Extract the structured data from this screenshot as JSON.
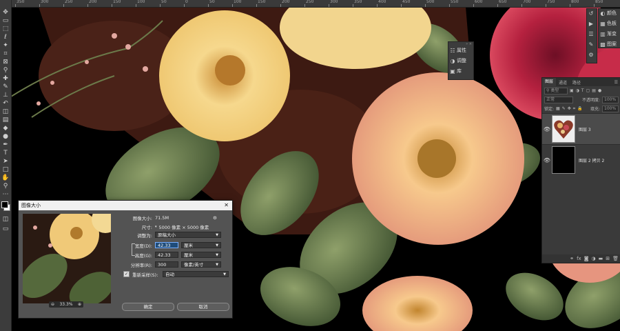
{
  "ruler": {
    "labels": [
      "350",
      "300",
      "250",
      "200",
      "150",
      "100",
      "50",
      "0",
      "50",
      "100",
      "150",
      "200",
      "250",
      "300",
      "350",
      "400",
      "450",
      "500",
      "550",
      "600",
      "650",
      "700",
      "750",
      "800",
      "850"
    ]
  },
  "toolbar": {
    "tools": [
      {
        "name": "move-tool-icon",
        "glyph": "✥"
      },
      {
        "name": "artboard-tool-icon",
        "glyph": "▭"
      },
      {
        "name": "marquee-tool-icon",
        "glyph": "⬚"
      },
      {
        "name": "lasso-tool-icon",
        "glyph": "ℓ"
      },
      {
        "name": "magic-wand-tool-icon",
        "glyph": "✦"
      },
      {
        "name": "crop-tool-icon",
        "glyph": "⌗"
      },
      {
        "name": "frame-tool-icon",
        "glyph": "⊠"
      },
      {
        "name": "eyedropper-tool-icon",
        "glyph": "⚲"
      },
      {
        "name": "healing-brush-tool-icon",
        "glyph": "✚"
      },
      {
        "name": "brush-tool-icon",
        "glyph": "✎"
      },
      {
        "name": "clone-stamp-tool-icon",
        "glyph": "⊥"
      },
      {
        "name": "history-brush-tool-icon",
        "glyph": "↶"
      },
      {
        "name": "eraser-tool-icon",
        "glyph": "◫"
      },
      {
        "name": "gradient-tool-icon",
        "glyph": "▤"
      },
      {
        "name": "blur-tool-icon",
        "glyph": "◆"
      },
      {
        "name": "dodge-tool-icon",
        "glyph": "●"
      },
      {
        "name": "pen-tool-icon",
        "glyph": "✒"
      },
      {
        "name": "type-tool-icon",
        "glyph": "T"
      },
      {
        "name": "path-selection-tool-icon",
        "glyph": "➤"
      },
      {
        "name": "shape-tool-icon",
        "glyph": "□"
      },
      {
        "name": "hand-tool-icon",
        "glyph": "✋"
      },
      {
        "name": "zoom-tool-icon",
        "glyph": "⚲"
      },
      {
        "name": "more-tools-icon",
        "glyph": "⋯"
      }
    ]
  },
  "right_panels": {
    "group1": [
      {
        "icon": "color-icon",
        "glyph": "◐",
        "label": "颜色"
      },
      {
        "icon": "swatches-icon",
        "glyph": "▦",
        "label": "色板"
      },
      {
        "icon": "gradients-icon",
        "glyph": "▥",
        "label": "渐变"
      },
      {
        "icon": "patterns-icon",
        "glyph": "▩",
        "label": "图案"
      }
    ],
    "group0_icons": [
      {
        "icon": "history-icon",
        "glyph": "↺"
      },
      {
        "icon": "play-icon",
        "glyph": "▶"
      },
      {
        "icon": "actions-icon",
        "glyph": "☰"
      },
      {
        "icon": "brush-settings-icon",
        "glyph": "✎"
      },
      {
        "icon": "tool-presets-icon",
        "glyph": "⚙"
      }
    ],
    "group2": [
      {
        "icon": "properties-icon",
        "glyph": "☷",
        "label": "属性"
      },
      {
        "icon": "adjustments-icon",
        "glyph": "◑",
        "label": "调整"
      },
      {
        "icon": "libraries-icon",
        "glyph": "▣",
        "label": "库"
      }
    ]
  },
  "layers_panel": {
    "tabs": [
      "图层",
      "通道",
      "路径"
    ],
    "filter_placeholder": "类型",
    "blend_mode": "正常",
    "opacity_label": "不透明度:",
    "opacity_value": "100%",
    "lock_label": "锁定:",
    "fill_label": "填充:",
    "fill_value": "100%",
    "layers": [
      {
        "name": "图层 3",
        "selected": true,
        "thumb": "heart-floral"
      },
      {
        "name": "图层 2 拷贝 2",
        "selected": false,
        "thumb": "black"
      }
    ],
    "footer_icons": [
      {
        "icon": "link-layers-icon",
        "glyph": "⚭"
      },
      {
        "icon": "fx-icon",
        "glyph": "fx"
      },
      {
        "icon": "mask-icon",
        "glyph": "◙"
      },
      {
        "icon": "adjustment-layer-icon",
        "glyph": "◑"
      },
      {
        "icon": "group-icon",
        "glyph": "▬"
      },
      {
        "icon": "new-layer-icon",
        "glyph": "⊞"
      },
      {
        "icon": "delete-layer-icon",
        "glyph": "🗑"
      }
    ]
  },
  "dialog": {
    "title": "图像大小",
    "image_size_label": "图像大小:",
    "image_size_value": "71.5M",
    "dimensions_label": "尺寸:",
    "dimensions_value": "5000 像素 × 5000 像素",
    "fit_to_label": "调整为:",
    "fit_to_value": "原稿大小",
    "width_label": "宽度(D):",
    "width_value": "42.33",
    "width_unit": "厘米",
    "height_label": "高度(G):",
    "height_value": "42.33",
    "height_unit": "厘米",
    "resolution_label": "分辨率(R):",
    "resolution_value": "300",
    "resolution_unit": "像素/英寸",
    "resample_label": "重新采样(S):",
    "resample_value": "自动",
    "resample_checked": true,
    "zoom_value": "33.3%",
    "ok_label": "确定",
    "cancel_label": "取消"
  }
}
